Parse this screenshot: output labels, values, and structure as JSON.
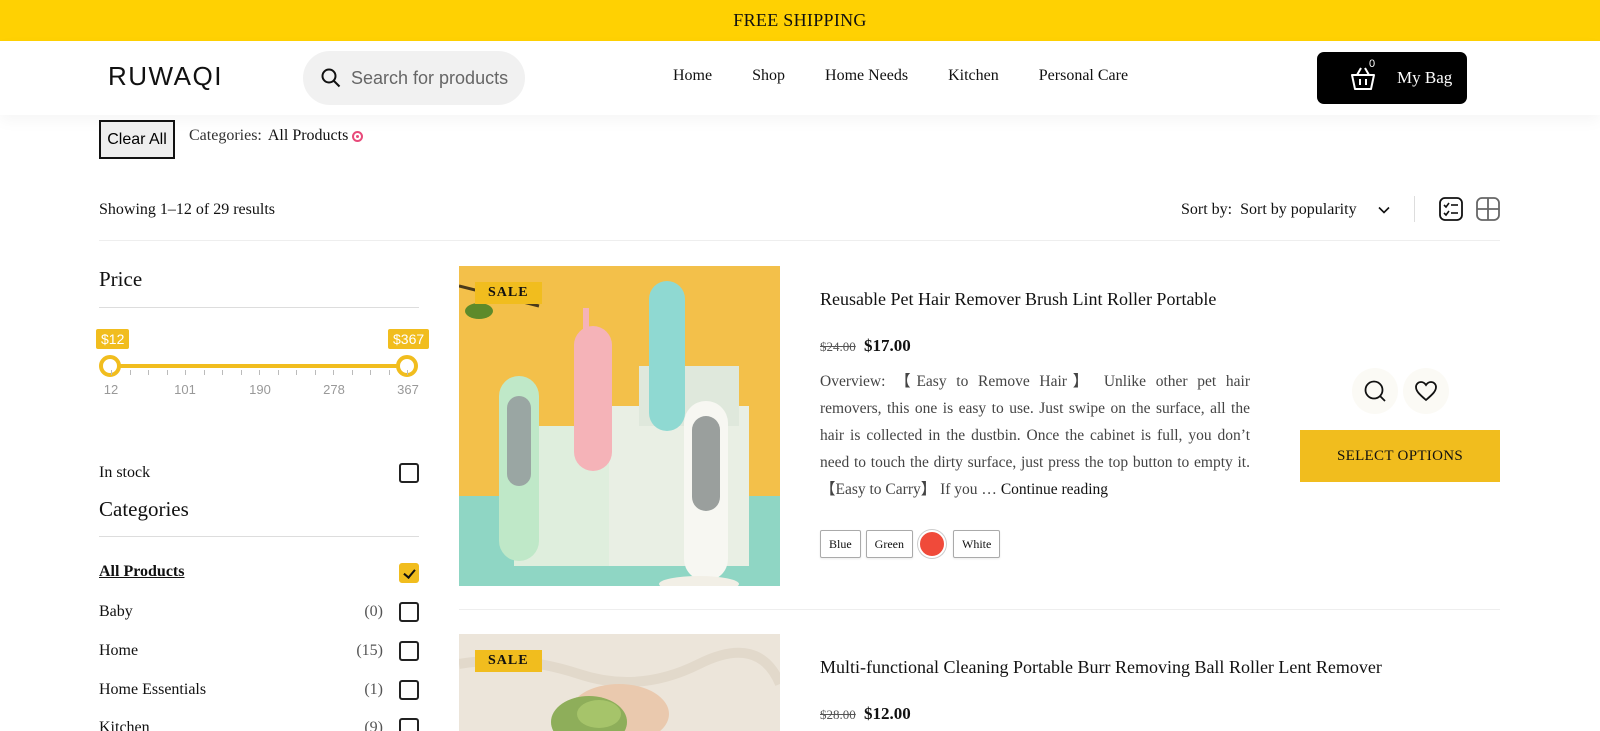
{
  "promo": {
    "text": "FREE SHIPPING"
  },
  "header": {
    "logo": "RUWAQI",
    "search_placeholder": "Search for products",
    "nav": [
      "Home",
      "Shop",
      "Home Needs",
      "Kitchen",
      "Personal Care"
    ],
    "bag_count": "0",
    "bag_label": "My Bag"
  },
  "filters": {
    "clear_all": "Clear All",
    "categories_label": "Categories:",
    "active_category": "All Products"
  },
  "results": {
    "showing": "Showing 1–12 of 29 results",
    "sort_label": "Sort by:",
    "sort_value": "Sort by popularity"
  },
  "sidebar": {
    "price_title": "Price",
    "price_min_label": "$12",
    "price_max_label": "$367",
    "price_min": 12,
    "price_max": 367,
    "price_ticks": [
      "12",
      "101",
      "190",
      "278",
      "367"
    ],
    "in_stock": "In stock",
    "categories_title": "Categories",
    "categories": [
      {
        "label": "All Products",
        "count": "",
        "checked": true
      },
      {
        "label": "Baby",
        "count": "(0)",
        "checked": false
      },
      {
        "label": "Home",
        "count": "(15)",
        "checked": false
      },
      {
        "label": "Home Essentials",
        "count": "(1)",
        "checked": false
      },
      {
        "label": "Kitchen",
        "count": "(9)",
        "checked": false
      }
    ]
  },
  "products": [
    {
      "badge": "SALE",
      "title": "Reusable Pet Hair Remover Brush Lint Roller Portable",
      "old_price": "$24.00",
      "price": "$17.00",
      "description": "Overview: 【Easy to Remove Hair】 Unlike other pet hair removers, this one is easy to use. Just swipe on the surface, all the hair is collected in the dustbin. Once the cabinet is full, you don’t need to touch the dirty surface, just press the top button to empty it. 【Easy to Carry】 If you …",
      "continue": "Continue reading",
      "swatches": [
        "Blue",
        "Green",
        "White"
      ],
      "swatch_color": "#f04a3a",
      "select_label": "SELECT OPTIONS"
    },
    {
      "badge": "SALE",
      "title": "Multi-functional Cleaning Portable Burr Removing Ball Roller Lent Remover",
      "old_price": "$28.00",
      "price": "$12.00"
    }
  ],
  "colors": {
    "accent": "#f1bd1e",
    "promo_bar": "#ffd102"
  }
}
